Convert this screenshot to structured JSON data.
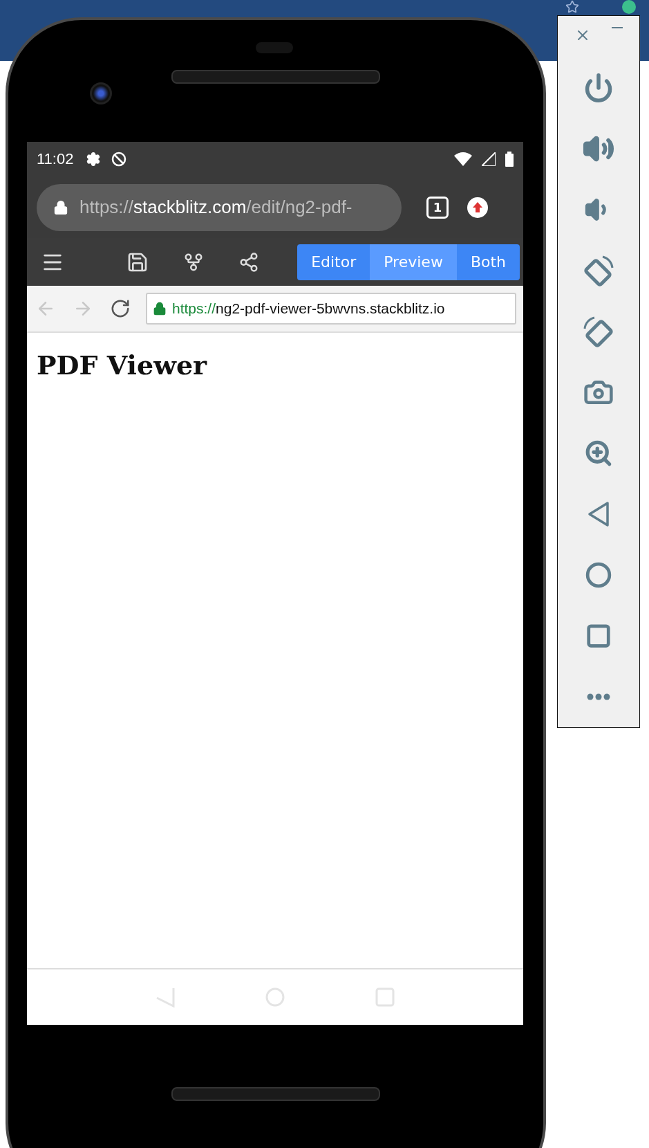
{
  "status_bar": {
    "time": "11:02"
  },
  "browser": {
    "url_scheme": "https://",
    "url_host": "stackblitz.com",
    "url_path": "/edit/ng2-pdf-",
    "tab_count": "1"
  },
  "stackblitz_toolbar": {
    "view_modes": [
      {
        "label": "Editor",
        "selected": false
      },
      {
        "label": "Preview",
        "selected": true
      },
      {
        "label": "Both",
        "selected": false
      }
    ]
  },
  "preview": {
    "back_disabled": true,
    "forward_disabled": true,
    "url_scheme": "https://",
    "url_rest": "ng2-pdf-viewer-5bwvns.stackblitz.io",
    "heading": "PDF Viewer"
  }
}
